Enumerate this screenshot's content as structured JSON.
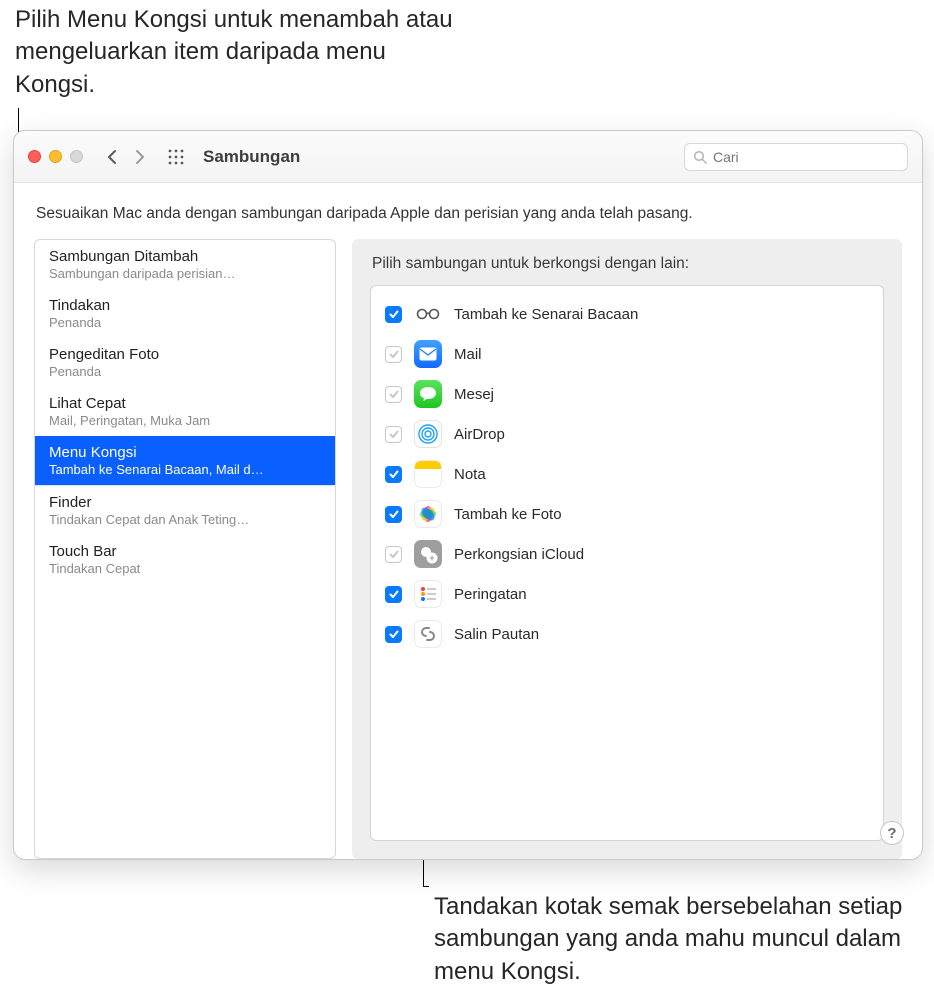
{
  "annotations": {
    "top": "Pilih Menu Kongsi untuk menambah atau mengeluarkan item daripada menu Kongsi.",
    "bottom": "Tandakan kotak semak bersebelahan setiap sambungan yang anda mahu muncul dalam menu Kongsi."
  },
  "window": {
    "title": "Sambungan",
    "search_placeholder": "Cari",
    "description": "Sesuaikan Mac anda dengan sambungan daripada Apple dan perisian yang anda telah pasang.",
    "help_label": "?"
  },
  "sidebar": {
    "items": [
      {
        "title": "Sambungan Ditambah",
        "sub": "Sambungan daripada perisian…",
        "selected": false,
        "divider_after": false
      },
      {
        "title": "Tindakan",
        "sub": "Penanda",
        "selected": false,
        "divider_after": false
      },
      {
        "title": "Pengeditan Foto",
        "sub": "Penanda",
        "selected": false,
        "divider_after": false
      },
      {
        "title": "Lihat Cepat",
        "sub": "Mail, Peringatan, Muka Jam",
        "selected": false,
        "divider_after": false
      },
      {
        "title": "Menu Kongsi",
        "sub": "Tambah ke Senarai Bacaan, Mail d…",
        "selected": true,
        "divider_after": true
      },
      {
        "title": "Finder",
        "sub": "Tindakan Cepat dan Anak Teting…",
        "selected": false,
        "divider_after": false
      },
      {
        "title": "Touch Bar",
        "sub": "Tindakan Cepat",
        "selected": false,
        "divider_after": false
      }
    ]
  },
  "detail": {
    "heading": "Pilih sambungan untuk berkongsi dengan lain:",
    "items": [
      {
        "label": "Tambah ke Senarai Bacaan",
        "checked": true,
        "enabled": true,
        "icon": "glasses"
      },
      {
        "label": "Mail",
        "checked": true,
        "enabled": false,
        "icon": "mail"
      },
      {
        "label": "Mesej",
        "checked": true,
        "enabled": false,
        "icon": "messages"
      },
      {
        "label": "AirDrop",
        "checked": true,
        "enabled": false,
        "icon": "airdrop"
      },
      {
        "label": "Nota",
        "checked": true,
        "enabled": true,
        "icon": "notes"
      },
      {
        "label": "Tambah ke Foto",
        "checked": true,
        "enabled": true,
        "icon": "photos"
      },
      {
        "label": "Perkongsian iCloud",
        "checked": true,
        "enabled": false,
        "icon": "icloud"
      },
      {
        "label": "Peringatan",
        "checked": true,
        "enabled": true,
        "icon": "reminders"
      },
      {
        "label": "Salin Pautan",
        "checked": true,
        "enabled": true,
        "icon": "link"
      }
    ]
  }
}
